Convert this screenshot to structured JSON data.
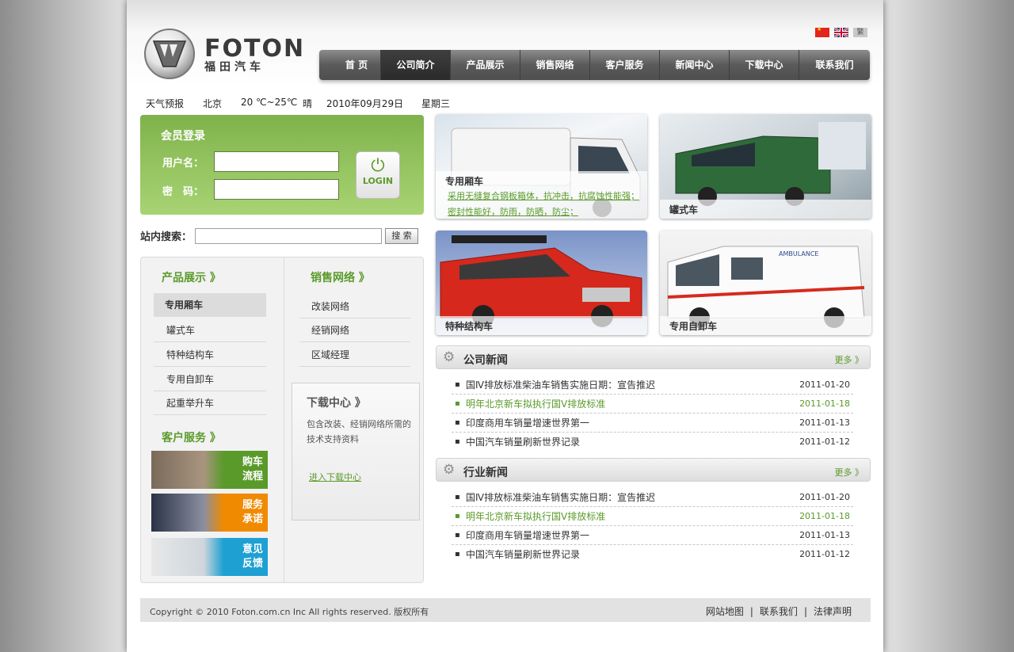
{
  "logo": {
    "brand": "FOTON",
    "brand_cn": "福田汽车"
  },
  "languages": [
    "中文",
    "English",
    "繁"
  ],
  "nav": [
    "首 页",
    "公司简介",
    "产品展示",
    "销售网络",
    "客户服务",
    "新闻中心",
    "下载中心",
    "联系我们"
  ],
  "weather": {
    "label": "天气预报",
    "city": "北京",
    "temp": "20 ℃~25℃",
    "condition": "晴",
    "date": "2010年09月29日",
    "weekday": "星期三"
  },
  "login": {
    "title": "会员登录",
    "username_label": "用户名：",
    "password_label": "密　码：",
    "username_value": "",
    "password_value": "",
    "button": "LOGIN"
  },
  "search": {
    "label": "站内搜索：",
    "value": "",
    "button": "搜 索"
  },
  "products_section": {
    "title": "产品展示 》",
    "items": [
      "专用厢车",
      "罐式车",
      "特种结构车",
      "专用自卸车",
      "起重举升车"
    ]
  },
  "sales_section": {
    "title": "销售网络 》",
    "items": [
      "改装网络",
      "经销网络",
      "区域经理"
    ]
  },
  "service_section": {
    "title": "客户服务 》",
    "banners": [
      {
        "line1": "购车",
        "line2": "流程",
        "color": "#5a9a2a"
      },
      {
        "line1": "服务",
        "line2": "承诺",
        "color": "#f08a00"
      },
      {
        "line1": "意见",
        "line2": "反馈",
        "color": "#1ea0d2"
      }
    ]
  },
  "download": {
    "title": "下载中心 》",
    "desc": "包含改装、经销网络所需的技术支持资料",
    "link": "进入下载中心"
  },
  "tiles": [
    {
      "title": "专用厢车",
      "desc": "采用无缝复合钢板箱体，抗冲击，抗腐蚀性能强；密封性能好，防雨，防晒，防尘；"
    },
    {
      "title": "罐式车"
    },
    {
      "title": "特种结构车"
    },
    {
      "title": "专用自卸车"
    }
  ],
  "company_news": {
    "title": "公司新闻",
    "more": "更多 》",
    "items": [
      {
        "title": "国Ⅳ排放标准柴油车销售实施日期：宣告推迟",
        "date": "2011-01-20"
      },
      {
        "title": "明年北京新车拟执行国Ⅴ排放标准",
        "date": "2011-01-18"
      },
      {
        "title": "印度商用车销量增速世界第一",
        "date": "2011-01-13"
      },
      {
        "title": "中国汽车销量刷新世界记录",
        "date": "2011-01-12"
      }
    ]
  },
  "industry_news": {
    "title": "行业新闻",
    "more": "更多 》",
    "items": [
      {
        "title": "国Ⅳ排放标准柴油车销售实施日期：宣告推迟",
        "date": "2011-01-20"
      },
      {
        "title": "明年北京新车拟执行国Ⅴ排放标准",
        "date": "2011-01-18"
      },
      {
        "title": "印度商用车销量增速世界第一",
        "date": "2011-01-13"
      },
      {
        "title": "中国汽车销量刷新世界记录",
        "date": "2011-01-12"
      }
    ]
  },
  "footer": {
    "copyright": "Copyright © 2010 Foton.com.cn Inc All rights reserved. 版权所有",
    "links": [
      "网站地图",
      "联系我们",
      "法律声明"
    ]
  },
  "colors": {
    "accent_green": "#5a9a2a",
    "nav_dark": "#4e4e4e"
  }
}
